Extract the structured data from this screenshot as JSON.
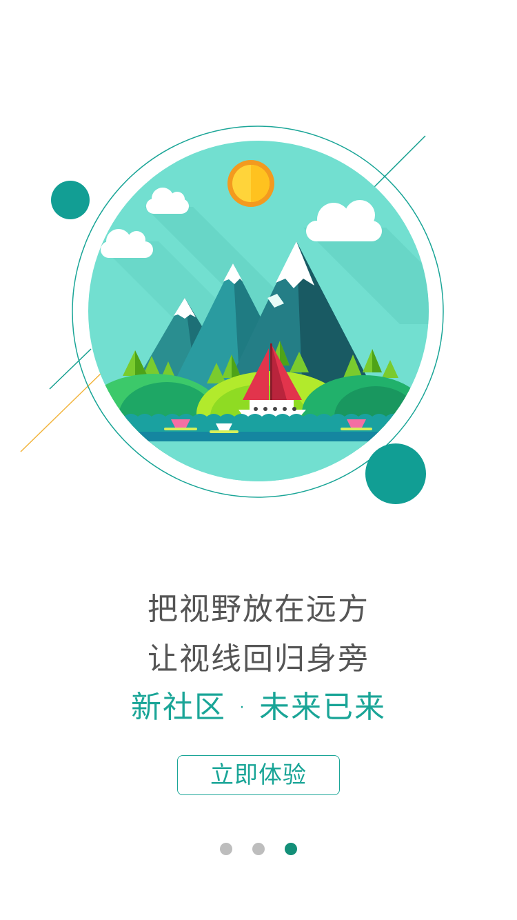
{
  "onboarding": {
    "headline_line1": "把视野放在远方",
    "headline_line2": "让视线回归身旁",
    "slogan": "新社区 · 未来已来",
    "cta_label": "立即体验",
    "page_indicator": {
      "total": 3,
      "active_index": 2
    }
  },
  "colors": {
    "accent": "#1aa597",
    "text_gray": "#555555",
    "dot_inactive": "#bdbdbd",
    "dot_active": "#138f78",
    "circle_dark_teal": "#119e94",
    "scene_sky": "#72dfd0"
  }
}
